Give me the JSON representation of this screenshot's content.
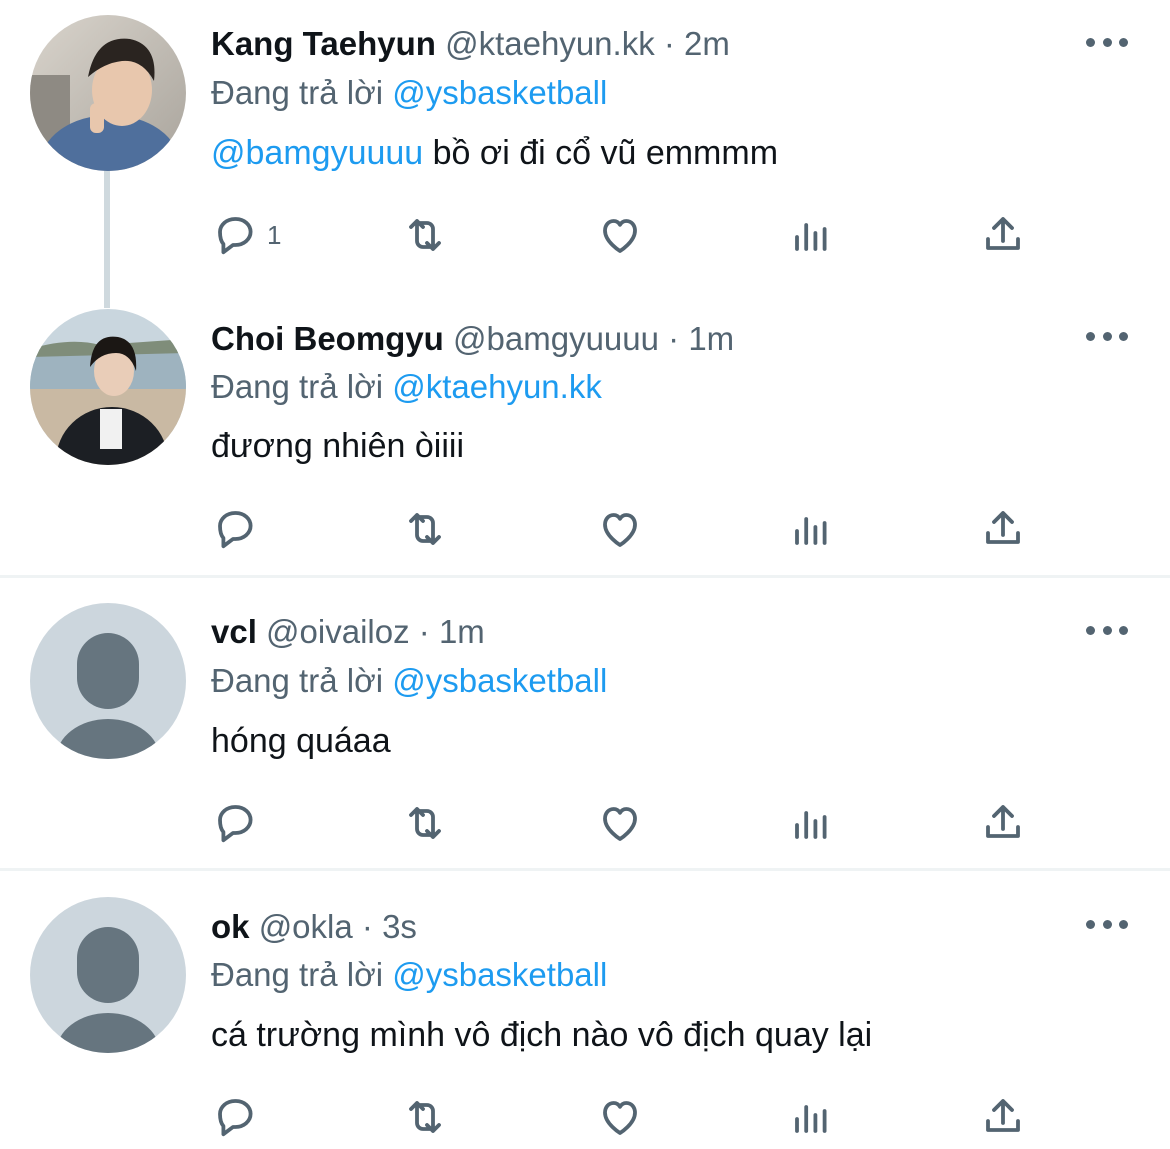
{
  "tweets": [
    {
      "name": "Kang Taehyun",
      "handle": "@ktaehyun.kk",
      "separator": "·",
      "time": "2m",
      "reply_prefix": "Đang trả lời",
      "reply_to": "@ysbasketball",
      "mention": "@bamgyuuuu",
      "text": " bồ ơi đi cổ vũ emmmm",
      "reply_count": "1",
      "avatar": "photo-avatar"
    },
    {
      "name": "Choi Beomgyu",
      "handle": "@bamgyuuuu",
      "separator": "·",
      "time": "1m",
      "reply_prefix": "Đang trả lời",
      "reply_to": "@ktaehyun.kk",
      "text": "đương nhiên òiiii",
      "avatar": "photo-avatar"
    },
    {
      "name": "vcl",
      "handle": "@oivailoz",
      "separator": "·",
      "time": "1m",
      "reply_prefix": "Đang trả lời",
      "reply_to": "@ysbasketball",
      "text": "hóng quáaa",
      "avatar": "default-avatar"
    },
    {
      "name": "ok",
      "handle": "@okla",
      "separator": "·",
      "time": "3s",
      "reply_prefix": "Đang trả lời",
      "reply_to": "@ysbasketball",
      "text": "cá trường mình vô địch nào vô địch quay lại",
      "avatar": "default-avatar"
    }
  ],
  "icons": {
    "reply": "reply-icon",
    "retweet": "retweet-icon",
    "like": "like-icon",
    "views": "views-icon",
    "share": "share-icon",
    "more": "more-icon"
  },
  "colors": {
    "link": "#1d9bf0",
    "secondary_text": "#536471",
    "primary_text": "#0f1419",
    "divider": "#eff3f4",
    "thread_line": "#cfd9de",
    "default_avatar_bg": "#ccd6dd",
    "default_avatar_fg": "#66757f"
  }
}
